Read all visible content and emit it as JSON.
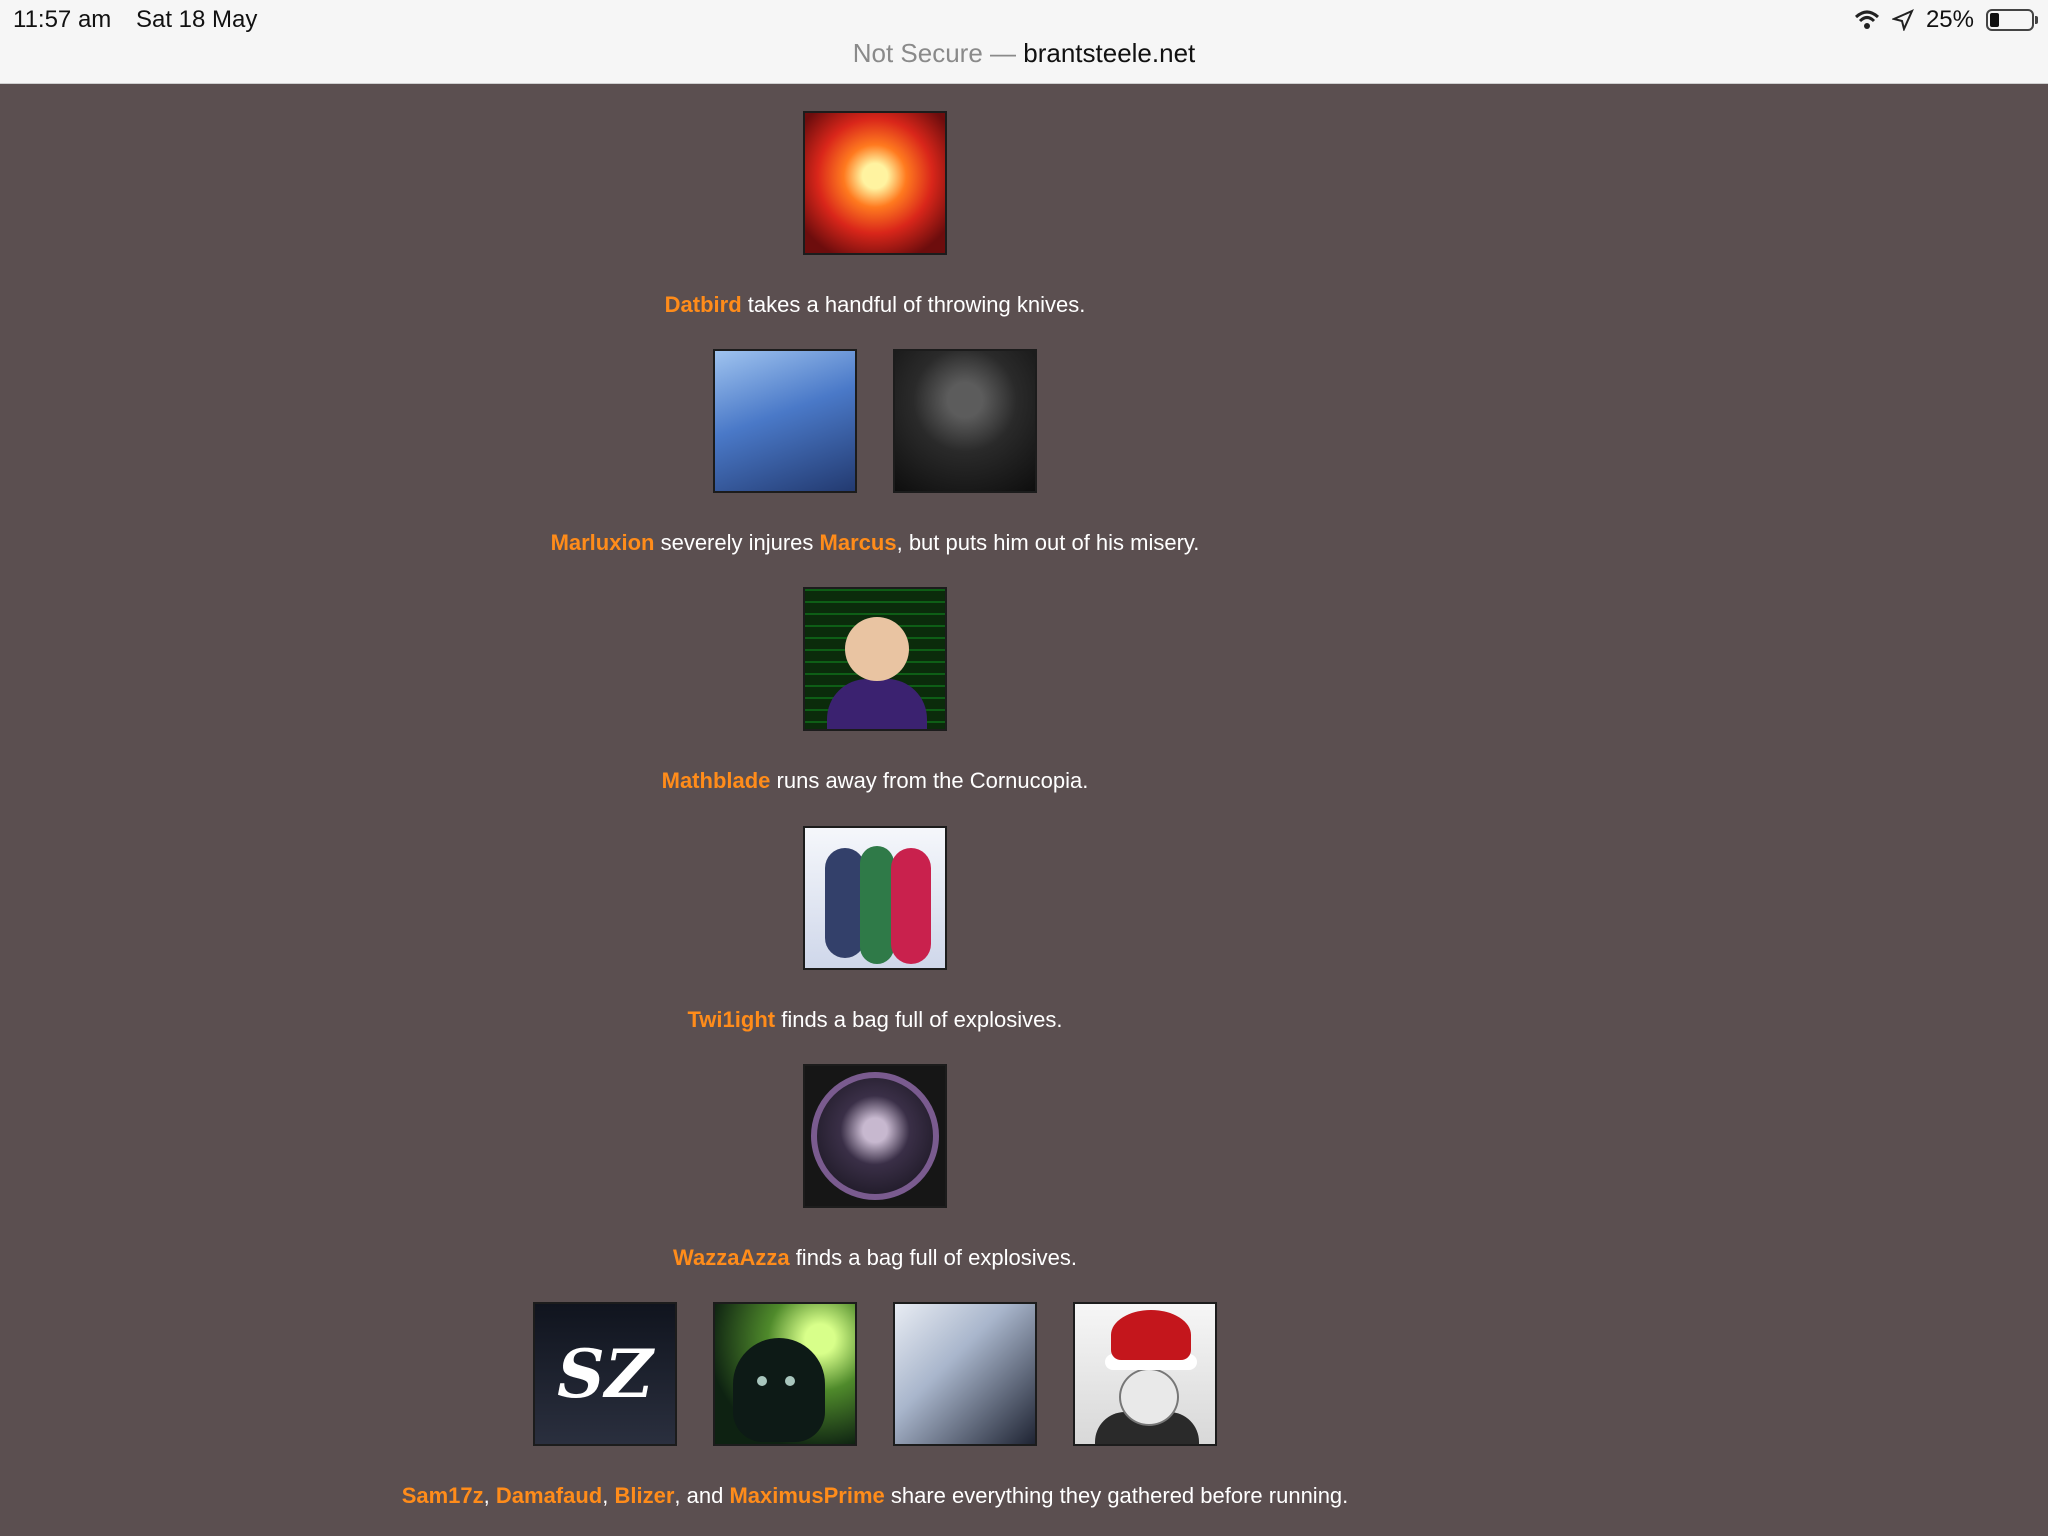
{
  "status_bar": {
    "time": "11:57 am",
    "date": "Sat 18 May",
    "battery": "25%",
    "wifi_icon": "wifi-icon",
    "location_icon": "location-arrow-icon"
  },
  "url_bar": {
    "security": "Not Secure —",
    "domain": "brantsteele.net"
  },
  "events": [
    {
      "names": [
        "Datbird"
      ],
      "text": " takes a handful of throwing knives."
    },
    {
      "names": [
        "Marluxion",
        "Marcus"
      ],
      "text_mid": " severely injures ",
      "text_end": ", but puts him out of his misery."
    },
    {
      "names": [
        "Mathblade"
      ],
      "text": " runs away from the Cornucopia."
    },
    {
      "names": [
        "Twi1ight"
      ],
      "text": " finds a bag full of explosives."
    },
    {
      "names": [
        "WazzaAzza"
      ],
      "text": " finds a bag full of explosives."
    },
    {
      "names": [
        "Sam17z",
        "Damafaud",
        "Blizer",
        "MaximusPrime"
      ],
      "sep1": ", ",
      "sep2": ", ",
      "sep3": ", and ",
      "text": " share everything they gathered before running.",
      "logo_text": "SZ"
    }
  ],
  "colors": {
    "background": "#5b4f50",
    "name": "#ff8c1a",
    "text": "#ffffff"
  }
}
